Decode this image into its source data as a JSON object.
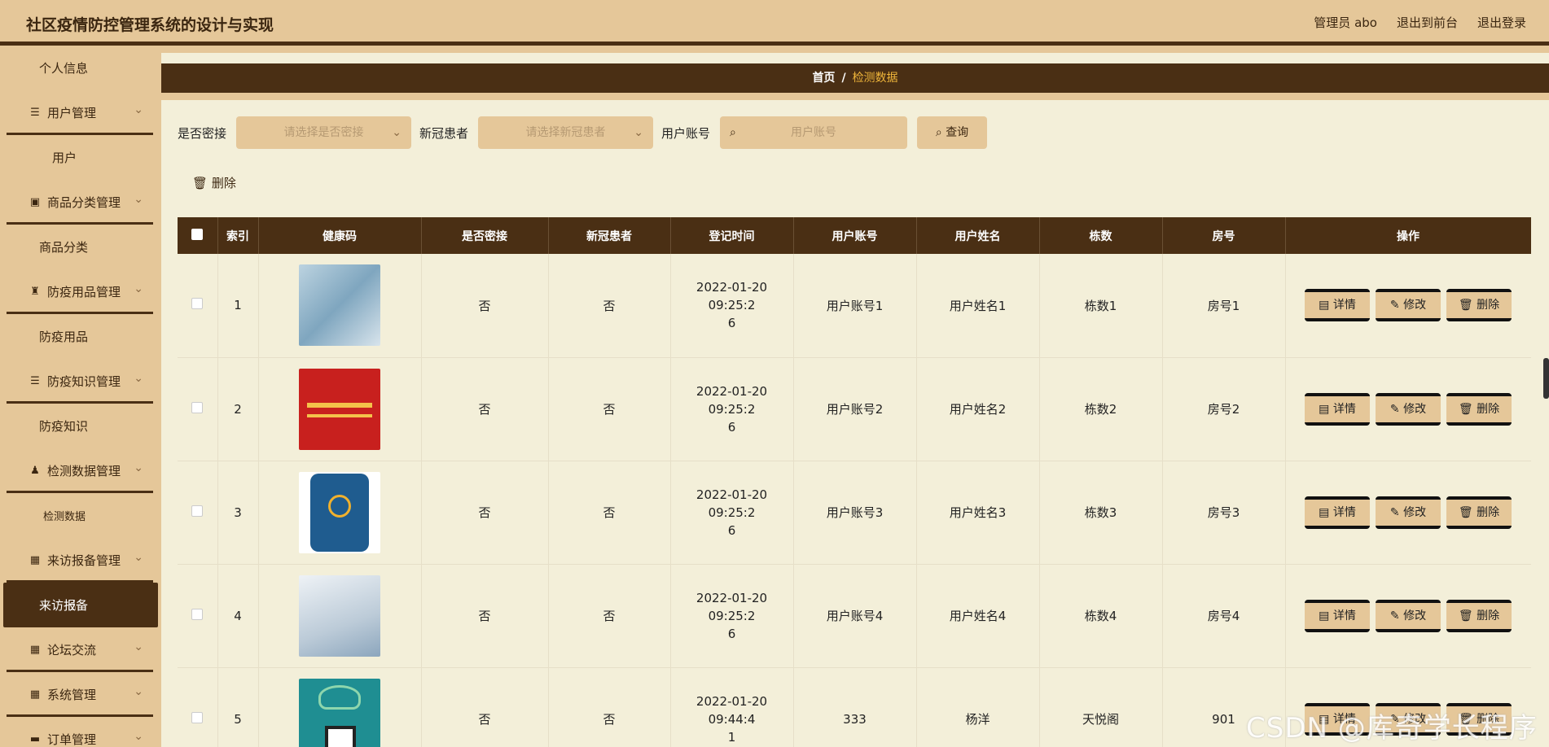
{
  "header": {
    "title": "社区疫情防控管理系统的设计与实现",
    "admin": "管理员 abo",
    "back_front": "退出到前台",
    "logout": "退出登录"
  },
  "sidebar": {
    "items": [
      {
        "type": "sub",
        "label": "个人信息"
      },
      {
        "type": "group",
        "label": "用户管理",
        "icon": "list-icon"
      },
      {
        "type": "sub",
        "label": "用户"
      },
      {
        "type": "group",
        "label": "商品分类管理",
        "icon": "clipboard-icon"
      },
      {
        "type": "sub",
        "label": "商品分类"
      },
      {
        "type": "group",
        "label": "防疫用品管理",
        "icon": "stamp-icon"
      },
      {
        "type": "sub",
        "label": "防疫用品"
      },
      {
        "type": "group",
        "label": "防疫知识管理",
        "icon": "list-icon"
      },
      {
        "type": "sub",
        "label": "防疫知识"
      },
      {
        "type": "group",
        "label": "检测数据管理",
        "icon": "user-icon"
      },
      {
        "type": "sub",
        "label": "检测数据"
      },
      {
        "type": "group",
        "label": "来访报备管理",
        "icon": "grid-icon"
      },
      {
        "type": "active",
        "label": "来访报备"
      },
      {
        "type": "group",
        "label": "论坛交流",
        "icon": "grid-icon"
      },
      {
        "type": "group",
        "label": "系统管理",
        "icon": "grid-icon"
      },
      {
        "type": "group",
        "label": "订单管理",
        "icon": "briefcase-icon"
      }
    ]
  },
  "breadcrumb": {
    "home": "首页",
    "sep": "/",
    "current": "检测数据"
  },
  "filters": {
    "contact_label": "是否密接",
    "contact_placeholder": "请选择是否密接",
    "patient_label": "新冠患者",
    "patient_placeholder": "请选择新冠患者",
    "account_label": "用户账号",
    "account_placeholder": "用户账号",
    "query_label": "查询"
  },
  "toolbar": {
    "delete_label": "删除"
  },
  "table": {
    "headers": [
      "索引",
      "健康码",
      "是否密接",
      "新冠患者",
      "登记时间",
      "用户账号",
      "用户姓名",
      "栋数",
      "房号",
      "操作"
    ],
    "actions": {
      "detail": "详情",
      "edit": "修改",
      "delete": "删除"
    },
    "rows": [
      {
        "index": "1",
        "contact": "否",
        "patient": "否",
        "time_a": "2022-01-20 09:25:2",
        "time_b": "6",
        "account": "用户账号1",
        "name": "用户姓名1",
        "building": "栋数1",
        "room": "房号1"
      },
      {
        "index": "2",
        "contact": "否",
        "patient": "否",
        "time_a": "2022-01-20 09:25:2",
        "time_b": "6",
        "account": "用户账号2",
        "name": "用户姓名2",
        "building": "栋数2",
        "room": "房号2"
      },
      {
        "index": "3",
        "contact": "否",
        "patient": "否",
        "time_a": "2022-01-20 09:25:2",
        "time_b": "6",
        "account": "用户账号3",
        "name": "用户姓名3",
        "building": "栋数3",
        "room": "房号3"
      },
      {
        "index": "4",
        "contact": "否",
        "patient": "否",
        "time_a": "2022-01-20 09:25:2",
        "time_b": "6",
        "account": "用户账号4",
        "name": "用户姓名4",
        "building": "栋数4",
        "room": "房号4"
      },
      {
        "index": "5",
        "contact": "否",
        "patient": "否",
        "time_a": "2022-01-20 09:44:4",
        "time_b": "1",
        "account": "333",
        "name": "杨洋",
        "building": "天悦阁",
        "room": "901"
      }
    ]
  },
  "watermark": "CSDN @库奇学长程序"
}
